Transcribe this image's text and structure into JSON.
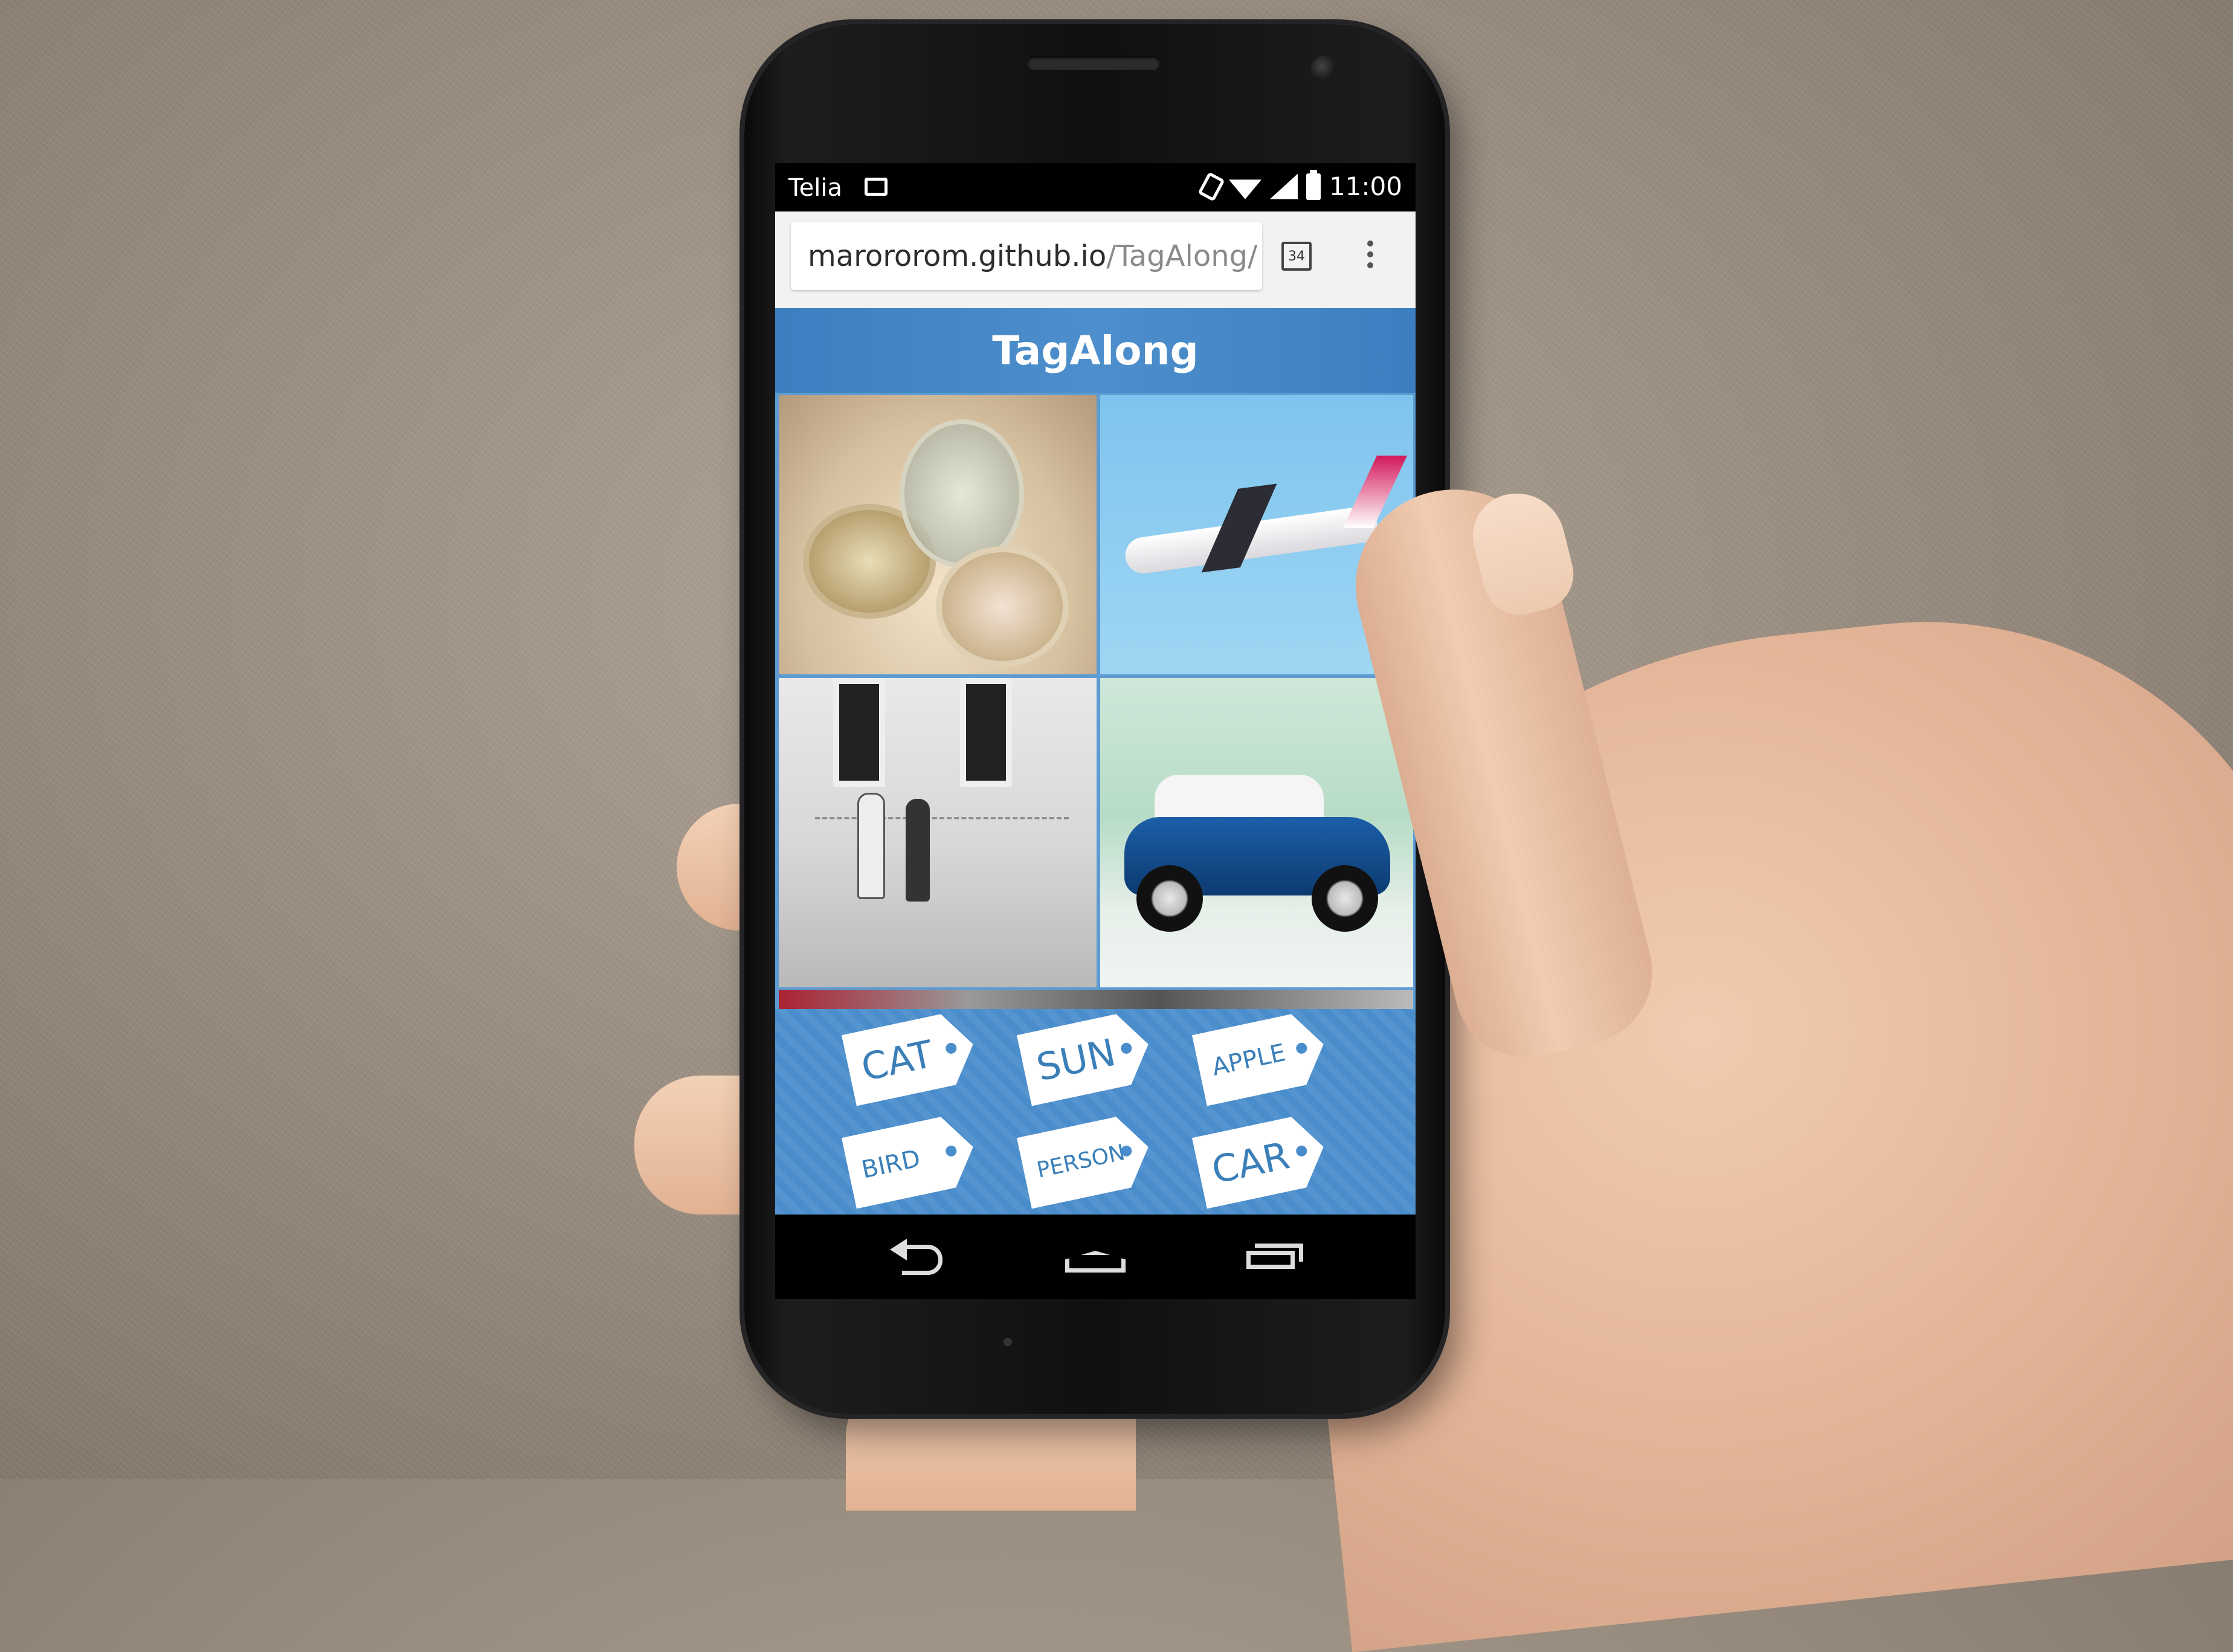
{
  "status_bar": {
    "carrier": "Telia",
    "time": "11:00"
  },
  "browser": {
    "url_host": "marororom.github.io",
    "url_path": "/TagAlong/",
    "tab_count": "34"
  },
  "app": {
    "title": "TagAlong"
  },
  "images": [
    {
      "name": "lenses"
    },
    {
      "name": "airplane"
    },
    {
      "name": "street"
    },
    {
      "name": "car"
    }
  ],
  "tags": [
    "CAT",
    "SUN",
    "APPLE",
    "BIRD",
    "PERSON",
    "CAR"
  ],
  "colors": {
    "header": "#4d8fcc",
    "tag_text": "#3b7fb8",
    "tag_panel": "#4a8dcc"
  }
}
